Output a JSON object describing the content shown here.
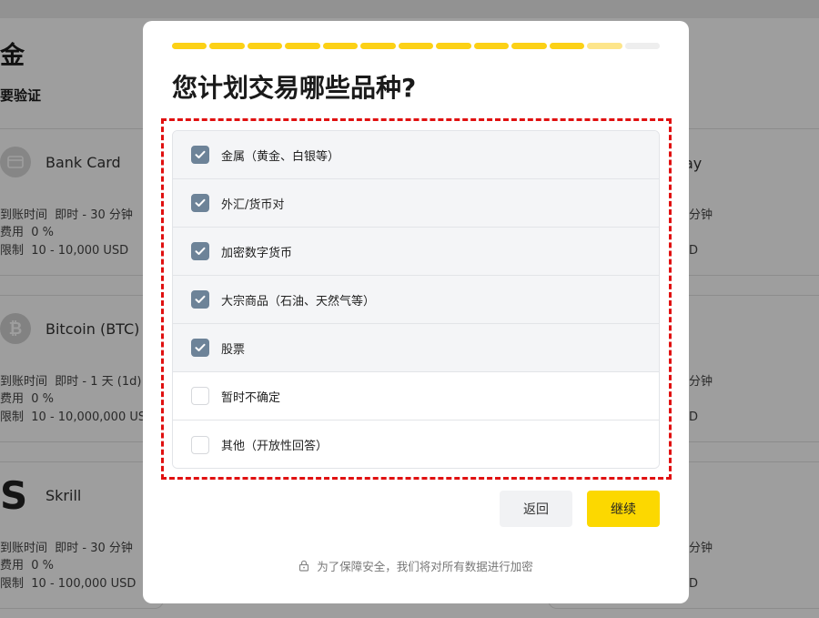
{
  "background": {
    "title": "金",
    "subtitle": "要验证",
    "methods": [
      {
        "name": "Bank Card",
        "icon": "credit-card-icon",
        "arrival_label": "到账时间",
        "arrival": "即时 - 30 分钟",
        "fee_label": "费用",
        "fee": "0 %",
        "limit_label": "限制",
        "limit": "10 - 10,000 USD"
      },
      {
        "name": "Bitcoin (BTC)",
        "icon": "bitcoin-icon",
        "arrival_label": "到账时间",
        "arrival": "即时 - 1 天 (1d)",
        "fee_label": "费用",
        "fee": "0 %",
        "limit_label": "限制",
        "limit": "10 - 10,000,000 USD"
      },
      {
        "name": "Skrill",
        "icon": "skrill-icon",
        "arrival_label": "到账时间",
        "arrival": "即时 - 30 分钟",
        "fee_label": "费用",
        "fee": "0 %",
        "limit_label": "限制",
        "limit": "10 - 100,000 USD"
      }
    ],
    "right_column": {
      "name_fragment": "ay",
      "rows": [
        {
          "arrival": "分钟",
          "limit": "D"
        },
        {
          "arrival": "分钟",
          "limit": "D"
        },
        {
          "arrival": "分钟",
          "limit": "D"
        }
      ]
    }
  },
  "modal": {
    "progress": {
      "total_steps": 13,
      "completed_steps": 11
    },
    "question": "您计划交易哪些品种?",
    "options": [
      {
        "label": "金属（黄金、白银等）",
        "checked": true
      },
      {
        "label": "外汇/货币对",
        "checked": true
      },
      {
        "label": "加密数字货币",
        "checked": true
      },
      {
        "label": "大宗商品（石油、天然气等）",
        "checked": true
      },
      {
        "label": "股票",
        "checked": true
      },
      {
        "label": "暂时不确定",
        "checked": false
      },
      {
        "label": "其他（开放性回答）",
        "checked": false
      }
    ],
    "back_label": "返回",
    "continue_label": "继续",
    "security_note": "为了保障安全，我们将对所有数据进行加密",
    "colors": {
      "accent": "#fcd800",
      "progress_done": "#fcd116",
      "progress_current": "#fde58a",
      "checkbox_checked": "#6d8398",
      "highlight": "#e01010"
    }
  }
}
